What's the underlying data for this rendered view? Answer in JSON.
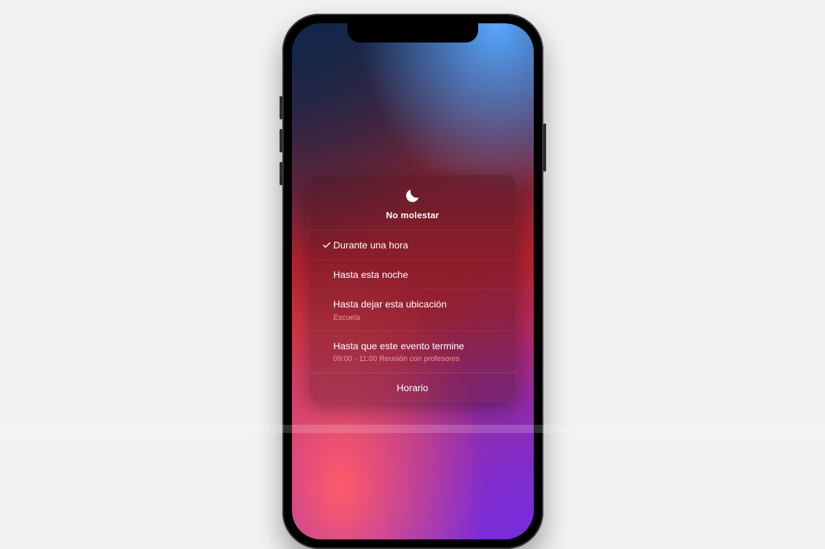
{
  "panel": {
    "title": "No molestar",
    "footer_label": "Horario",
    "options": [
      {
        "label": "Durante una hora",
        "sub": "",
        "selected": true
      },
      {
        "label": "Hasta esta noche",
        "sub": "",
        "selected": false
      },
      {
        "label": "Hasta dejar esta ubicación",
        "sub": "Escuela",
        "selected": false
      },
      {
        "label": "Hasta que este evento termine",
        "sub": "09:00 - 11:00 Reunión con profesores",
        "selected": false
      }
    ]
  },
  "icons": {
    "header": "moon-icon",
    "check": "checkmark-icon"
  }
}
